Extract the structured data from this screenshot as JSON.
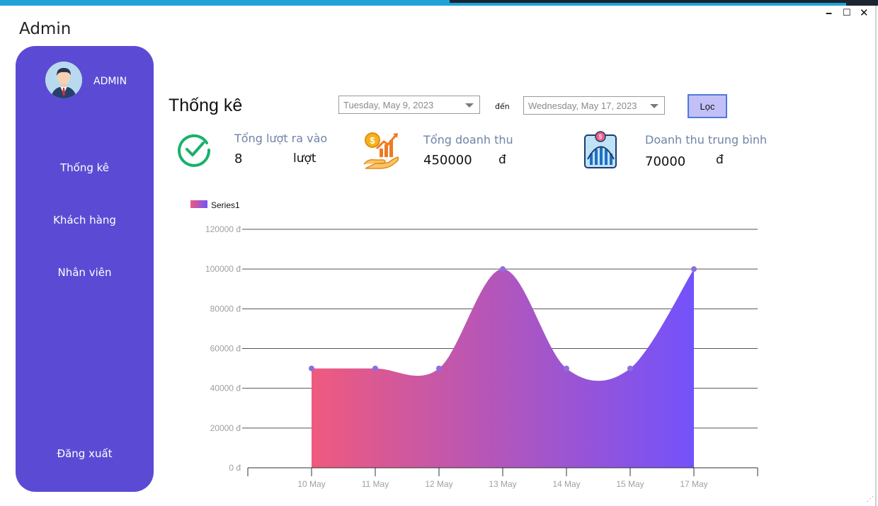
{
  "window": {
    "title": "Admin",
    "minimize": "🗕",
    "maximize": "☐",
    "close": "✕"
  },
  "sidebar": {
    "user": "ADMIN",
    "items": [
      {
        "label": "Thống kê"
      },
      {
        "label": "Khách hàng"
      },
      {
        "label": "Nhân viên"
      }
    ],
    "logout": "Đăng xuất"
  },
  "main": {
    "title": "Thống kê",
    "date_from": "Tuesday, May 9, 2023",
    "to_label": "đến",
    "date_to": "Wednesday, May 17, 2023",
    "filter_button": "Lọc"
  },
  "stats": [
    {
      "label": "Tổng lượt ra vào",
      "value": "8",
      "unit": "lượt",
      "icon": "check-circle-icon"
    },
    {
      "label": "Tổng doanh thu",
      "value": "450000",
      "unit": "đ",
      "icon": "revenue-growth-icon"
    },
    {
      "label": "Doanh thu trung bình",
      "value": "70000",
      "unit": "đ",
      "icon": "average-chart-icon"
    }
  ],
  "colors": {
    "sidebar": "#5b4bd4",
    "accent_blue": "#1fa3d8",
    "gradient_start": "#ef5a7e",
    "gradient_end": "#7352fb",
    "point": "#8c6fe0",
    "stat_label": "#7084a8"
  },
  "chart_data": {
    "type": "area",
    "categories": [
      "10 May",
      "11 May",
      "12 May",
      "13 May",
      "14 May",
      "15 May",
      "17 May"
    ],
    "series": [
      {
        "name": "Series1",
        "values": [
          50000,
          50000,
          50000,
          100000,
          50000,
          50000,
          100000
        ]
      }
    ],
    "y_ticks": [
      "0 đ",
      "20000 đ",
      "40000 đ",
      "60000 đ",
      "80000 đ",
      "100000 đ",
      "120000 đ"
    ],
    "ylim": [
      0,
      120000
    ],
    "grid": true,
    "legend": "top-left",
    "smooth": true
  }
}
